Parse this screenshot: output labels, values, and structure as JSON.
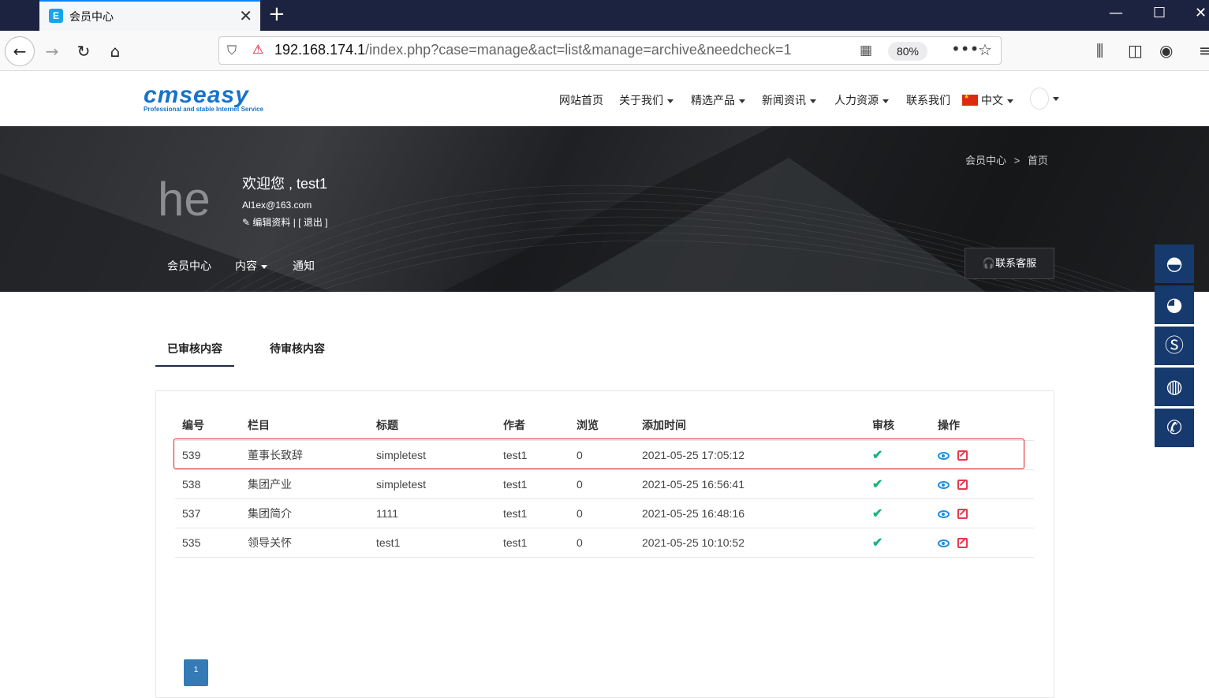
{
  "browser": {
    "tab_title": "会员中心",
    "tab_favicon_letter": "E",
    "url_host": "192.168.174.1",
    "url_path": "/index.php?case=manage&act=list&manage=archive&needcheck=1",
    "zoom": "80%"
  },
  "header": {
    "logo_text": "cmseasy",
    "logo_tagline": "Professional and stable Internet Service",
    "nav": [
      {
        "label": "网站首页"
      },
      {
        "label": "关于我们"
      },
      {
        "label": "精选产品"
      },
      {
        "label": "新闻资讯"
      },
      {
        "label": "人力资源"
      },
      {
        "label": "联系我们"
      },
      {
        "label": "中文"
      }
    ]
  },
  "banner": {
    "avatar_text": "he",
    "welcome": "欢迎您 , test1",
    "email": "Al1ex@163.com",
    "edit_profile": "编辑资料",
    "logout": "[ 退出 ]",
    "breadcrumb": {
      "home": "会员中心",
      "sep": ">",
      "current": "首页"
    },
    "subnav": [
      "会员中心",
      "内容",
      "通知"
    ],
    "service_button": "联系客服"
  },
  "content_tabs": [
    "已审核内容",
    "待审核内容"
  ],
  "table": {
    "headers": [
      "编号",
      "栏目",
      "标题",
      "作者",
      "浏览",
      "添加时间",
      "审核",
      "操作"
    ],
    "rows": [
      {
        "id": "539",
        "category": "董事长致辞",
        "title": "simpletest",
        "author": "test1",
        "views": "0",
        "time": "2021-05-25 17:05:12"
      },
      {
        "id": "538",
        "category": "集团产业",
        "title": "simpletest",
        "author": "test1",
        "views": "0",
        "time": "2021-05-25 16:56:41"
      },
      {
        "id": "537",
        "category": "集团简介",
        "title": "1111",
        "author": "test1",
        "views": "0",
        "time": "2021-05-25 16:48:16"
      },
      {
        "id": "535",
        "category": "领导关怀",
        "title": "test1",
        "author": "test1",
        "views": "0",
        "time": "2021-05-25 10:10:52"
      }
    ]
  },
  "pager": {
    "current": "1"
  },
  "sidebar_icons": [
    "qq-icon",
    "weibo-icon",
    "skype-icon",
    "wechat-icon",
    "phone-icon"
  ],
  "colors": {
    "accent": "#1e2a44",
    "sidebar": "#163a6e",
    "highlight": "#e02020",
    "check": "#1bb57b"
  }
}
